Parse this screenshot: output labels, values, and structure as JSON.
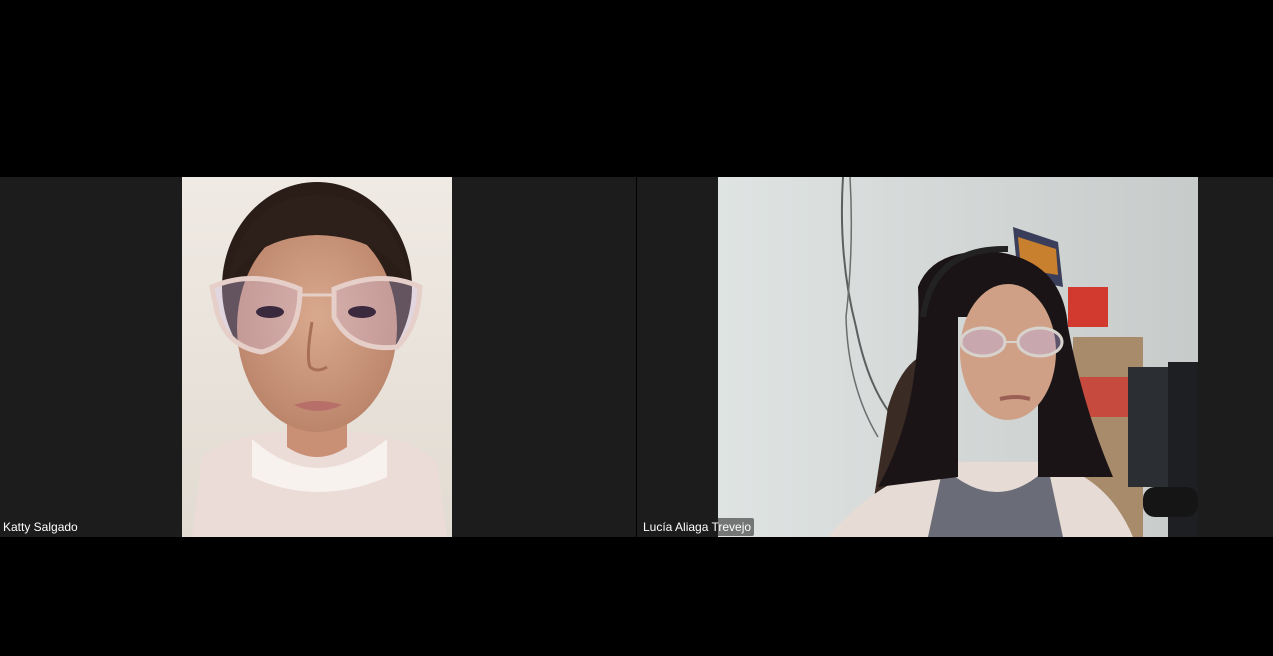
{
  "meeting": {
    "participants": [
      {
        "name": "Katty Salgado"
      },
      {
        "name": "Lucía Aliaga Trevejo"
      }
    ]
  }
}
